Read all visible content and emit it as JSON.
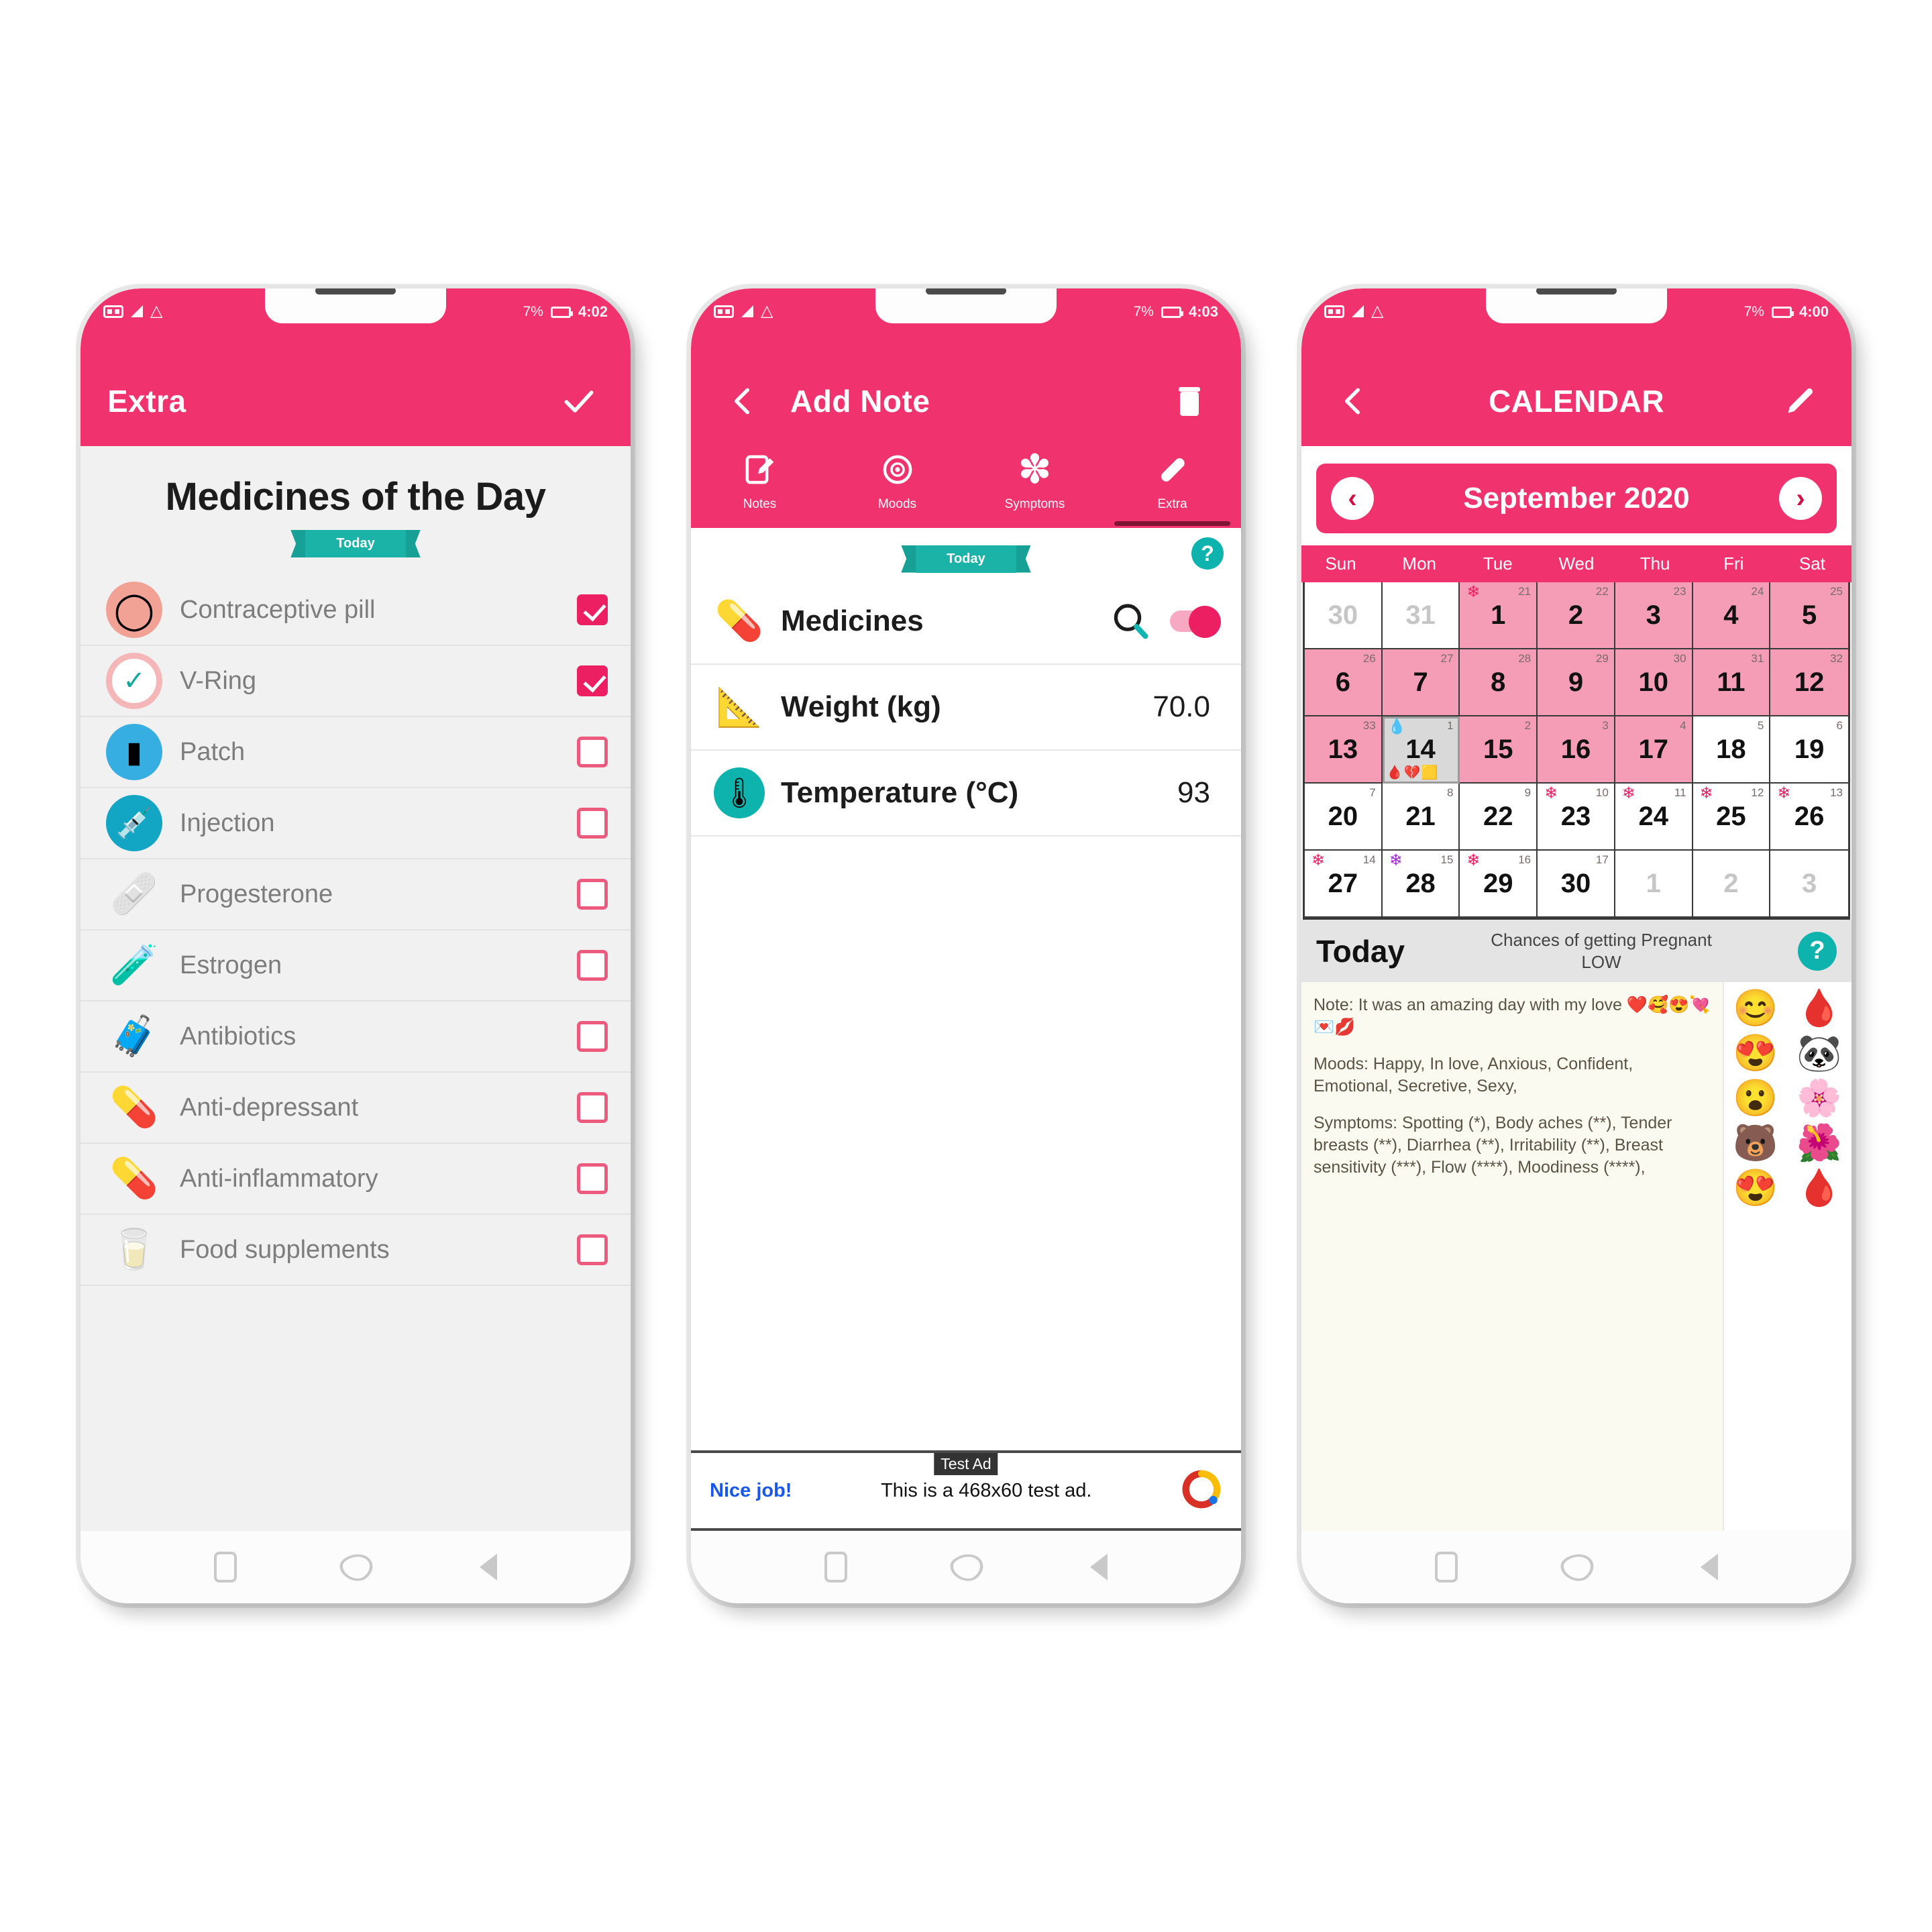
{
  "theme": {
    "pink": "#f0326e",
    "pink_dark": "#d11146",
    "teal": "#0fb3ad",
    "grey_bg": "#f1f1f1"
  },
  "status_bar": {
    "sim_icon": "sim-card-icon",
    "signal_icon": "signal-icon",
    "wifi_icon": "wifi-icon",
    "battery_icon": "battery-icon",
    "battery_pct": "7%",
    "times": [
      "4:02",
      "4:03",
      "4:00"
    ]
  },
  "nav_bar": {
    "recents": "recents-square-icon",
    "home": "home-icon",
    "back": "back-triangle-icon"
  },
  "phone1": {
    "appbar": {
      "title": "Extra",
      "confirm_icon": "check-icon"
    },
    "heading": "Medicines of the Day",
    "ribbon": "Today",
    "medicines": [
      {
        "name": "Contraceptive pill",
        "icon": "pill-tablet-icon",
        "checked": true
      },
      {
        "name": "V-Ring",
        "icon": "vaginal-ring-icon",
        "checked": true
      },
      {
        "name": "Patch",
        "icon": "patch-icon",
        "checked": false
      },
      {
        "name": "Injection",
        "icon": "syringe-icon",
        "checked": false
      },
      {
        "name": "Progesterone",
        "icon": "bandage-icon",
        "checked": false
      },
      {
        "name": "Estrogen",
        "icon": "bottle-icon",
        "checked": false
      },
      {
        "name": "Antibiotics",
        "icon": "medicine-bottle-icon",
        "checked": false
      },
      {
        "name": "Anti-depressant",
        "icon": "capsule-smiley-icon",
        "checked": false
      },
      {
        "name": "Anti-inflammatory",
        "icon": "capsule-icon",
        "checked": false
      },
      {
        "name": "Food supplements",
        "icon": "supplement-icon",
        "checked": false
      }
    ]
  },
  "phone2": {
    "appbar": {
      "back_icon": "chevron-left-icon",
      "title": "Add Note",
      "delete_icon": "trash-icon"
    },
    "tabs": [
      {
        "label": "Notes",
        "icon": "note-edit-icon",
        "active": false
      },
      {
        "label": "Moods",
        "icon": "mood-face-icon",
        "active": false
      },
      {
        "label": "Symptoms",
        "icon": "asterisk-flower-icon",
        "active": false
      },
      {
        "label": "Extra",
        "icon": "capsule-icon",
        "active": true
      }
    ],
    "ribbon": "Today",
    "help_icon": "help-question-icon",
    "rows": [
      {
        "label": "Medicines",
        "icon": "capsule-icon",
        "value": "",
        "control": "search+toggle",
        "search_icon": "search-icon",
        "toggle_on": true
      },
      {
        "label": "Weight (kg)",
        "icon": "weight-scale-icon",
        "value": "70.0",
        "control": "value"
      },
      {
        "label": "Temperature (°C)",
        "icon": "thermometer-icon",
        "value": "93",
        "control": "value"
      }
    ],
    "ad": {
      "tag": "Test Ad",
      "link": "Nice job!",
      "text": "This is a 468x60 test ad.",
      "logo": "google-ads-icon"
    }
  },
  "phone3": {
    "appbar": {
      "back_icon": "chevron-left-icon",
      "title": "CALENDAR",
      "edit_icon": "pencil-icon"
    },
    "month": "September 2020",
    "prev_icon": "chevron-left-circle-icon",
    "next_icon": "chevron-right-circle-icon",
    "dow": [
      "Sun",
      "Mon",
      "Tue",
      "Wed",
      "Thu",
      "Fri",
      "Sat"
    ],
    "cells": [
      {
        "d": "30",
        "state": "dim"
      },
      {
        "d": "31",
        "state": "dim"
      },
      {
        "d": "1",
        "state": "pink",
        "sub": "21",
        "flower": true
      },
      {
        "d": "2",
        "state": "pink",
        "sub": "22"
      },
      {
        "d": "3",
        "state": "pink",
        "sub": "23"
      },
      {
        "d": "4",
        "state": "pink",
        "sub": "24"
      },
      {
        "d": "5",
        "state": "pink",
        "sub": "25"
      },
      {
        "d": "6",
        "state": "pink",
        "sub": "26"
      },
      {
        "d": "7",
        "state": "pink",
        "sub": "27"
      },
      {
        "d": "8",
        "state": "pink",
        "sub": "28"
      },
      {
        "d": "9",
        "state": "pink",
        "sub": "29"
      },
      {
        "d": "10",
        "state": "pink",
        "sub": "30"
      },
      {
        "d": "11",
        "state": "pink",
        "sub": "31"
      },
      {
        "d": "12",
        "state": "pink",
        "sub": "32"
      },
      {
        "d": "13",
        "state": "pink",
        "sub": "33"
      },
      {
        "d": "14",
        "state": "today",
        "sub": "1",
        "top_marks": "💧",
        "bottom_marks": "🩸💔🟨"
      },
      {
        "d": "15",
        "state": "pink",
        "sub": "2"
      },
      {
        "d": "16",
        "state": "pink",
        "sub": "3"
      },
      {
        "d": "17",
        "state": "pink",
        "sub": "4"
      },
      {
        "d": "18",
        "state": "white",
        "sub": "5"
      },
      {
        "d": "19",
        "state": "white",
        "sub": "6"
      },
      {
        "d": "20",
        "state": "white",
        "sub": "7"
      },
      {
        "d": "21",
        "state": "white",
        "sub": "8"
      },
      {
        "d": "22",
        "state": "white",
        "sub": "9"
      },
      {
        "d": "23",
        "state": "white",
        "sub": "10",
        "flower": true
      },
      {
        "d": "24",
        "state": "white",
        "sub": "11",
        "flower": true
      },
      {
        "d": "25",
        "state": "white",
        "sub": "12",
        "flower": true
      },
      {
        "d": "26",
        "state": "white",
        "sub": "13",
        "flower": true
      },
      {
        "d": "27",
        "state": "white",
        "sub": "14",
        "flower": true
      },
      {
        "d": "28",
        "state": "white",
        "sub": "15",
        "flower_purple": true
      },
      {
        "d": "29",
        "state": "white",
        "sub": "16",
        "flower": true
      },
      {
        "d": "30",
        "state": "white",
        "sub": "17"
      },
      {
        "d": "1",
        "state": "dim"
      },
      {
        "d": "2",
        "state": "dim"
      },
      {
        "d": "3",
        "state": "dim"
      }
    ],
    "today_bar": {
      "label": "Today",
      "chance_line1": "Chances of getting Pregnant",
      "chance_line2": "LOW",
      "help_icon": "help-question-icon"
    },
    "note": {
      "line_note": "Note: It was an amazing day with my love ❤️🥰😍💘💌💋",
      "line_moods": "Moods: Happy, In love, Anxious, Confident, Emotional, Secretive, Sexy,",
      "line_symptoms": "Symptoms: Spotting (*), Body aches (**), Tender breasts (**), Diarrhea (**), Irritability (**), Breast sensitivity (***), Flow (****), Moodiness (****),"
    },
    "mood_emojis": [
      "😊",
      "😍",
      "😮",
      "🐻",
      "😍"
    ],
    "symptom_emojis": [
      "🩸",
      "🐼",
      "🌸",
      "🌺",
      "🩸"
    ]
  }
}
